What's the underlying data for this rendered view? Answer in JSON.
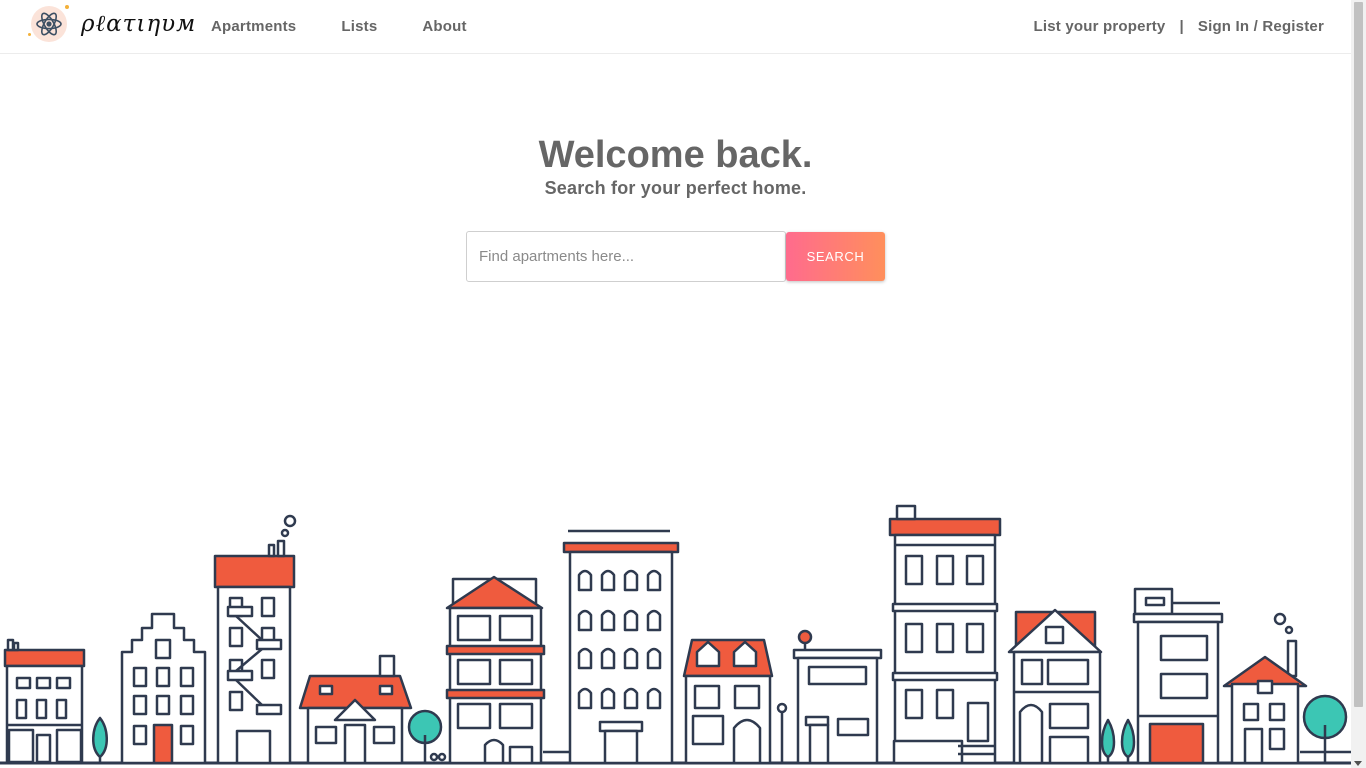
{
  "header": {
    "brand_name": "ρℓατιηυм",
    "nav": [
      {
        "label": "Apartments"
      },
      {
        "label": "Lists"
      },
      {
        "label": "About"
      }
    ],
    "list_property": "List your property",
    "separator": "|",
    "sign_in": "Sign In / Register"
  },
  "hero": {
    "title": "Welcome back.",
    "subtitle": "Search for your perfect home."
  },
  "search": {
    "placeholder": "Find apartments here...",
    "button_label": "SEARCH"
  },
  "colors": {
    "accent_start": "#ff6b8d",
    "accent_end": "#ff8f5c",
    "roof_red": "#ef5b3e",
    "outline_navy": "#2f3a4f",
    "tree_teal": "#3cc6b4"
  },
  "illustration": {
    "name": "city-skyline-illustration"
  }
}
